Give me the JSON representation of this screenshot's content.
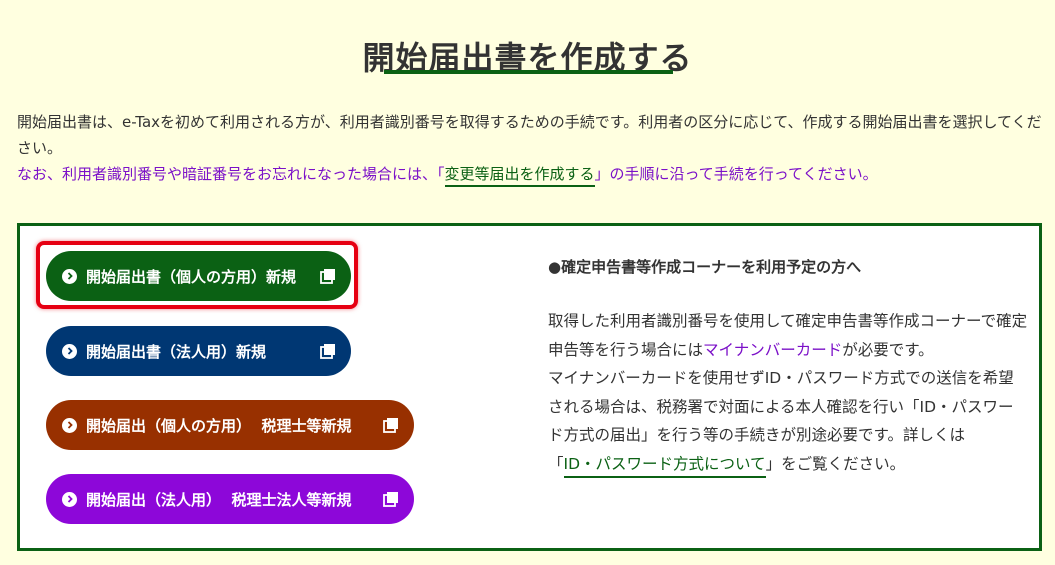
{
  "page": {
    "title": "開始届出書を作成する"
  },
  "intro": {
    "line1": "開始届出書は、e-Taxを初めて利用される方が、利用者識別番号を取得するための手続です。利用者の区分に応じて、作成する開始届出書を選択してください。",
    "line2_prefix": "なお、利用者識別番号や暗証番号をお忘れになった場合には、「",
    "line2_link": "変更等届出を作成する",
    "line2_suffix": "」の手順に沿って手続を行ってください。"
  },
  "buttons": [
    {
      "label": "開始届出書（個人の方用）新規",
      "color": "#0b6114",
      "icon": "new-window-icon",
      "highlighted": true
    },
    {
      "label": "開始届出書（法人用）新規",
      "color": "#003773",
      "icon": "new-window-icon",
      "highlighted": false
    },
    {
      "label": "開始届出（個人の方用）  税理士等新規",
      "color": "#983000",
      "icon": "new-window-icon",
      "highlighted": false
    },
    {
      "label": "開始届出（法人用）  税理士法人等新規",
      "color": "#8d07d9",
      "icon": "new-window-icon",
      "highlighted": false
    }
  ],
  "info": {
    "heading": "●確定申告書等作成コーナーを利用予定の方へ",
    "p1_a": "取得した利用者識別番号を使用して確定申告書等作成コーナーで確定申告等を行う場合には",
    "p1_mn": "マイナンバーカード",
    "p1_b": "が必要です。",
    "p2": "マイナンバーカードを使用せずID・パスワード方式での送信を希望される場合は、税務署で対面による本人確認を行い「ID・パスワード方式の届出」を行う等の手続きが別途必要です。詳しくは",
    "p3_open": "「",
    "p3_link": "ID・パスワード方式について",
    "p3_close": "」をご覧ください。"
  },
  "colors": {
    "background": "#ffffe0",
    "accent_green": "#0b6114",
    "highlight_red": "#e60012",
    "purple_text": "#7b10c8"
  }
}
